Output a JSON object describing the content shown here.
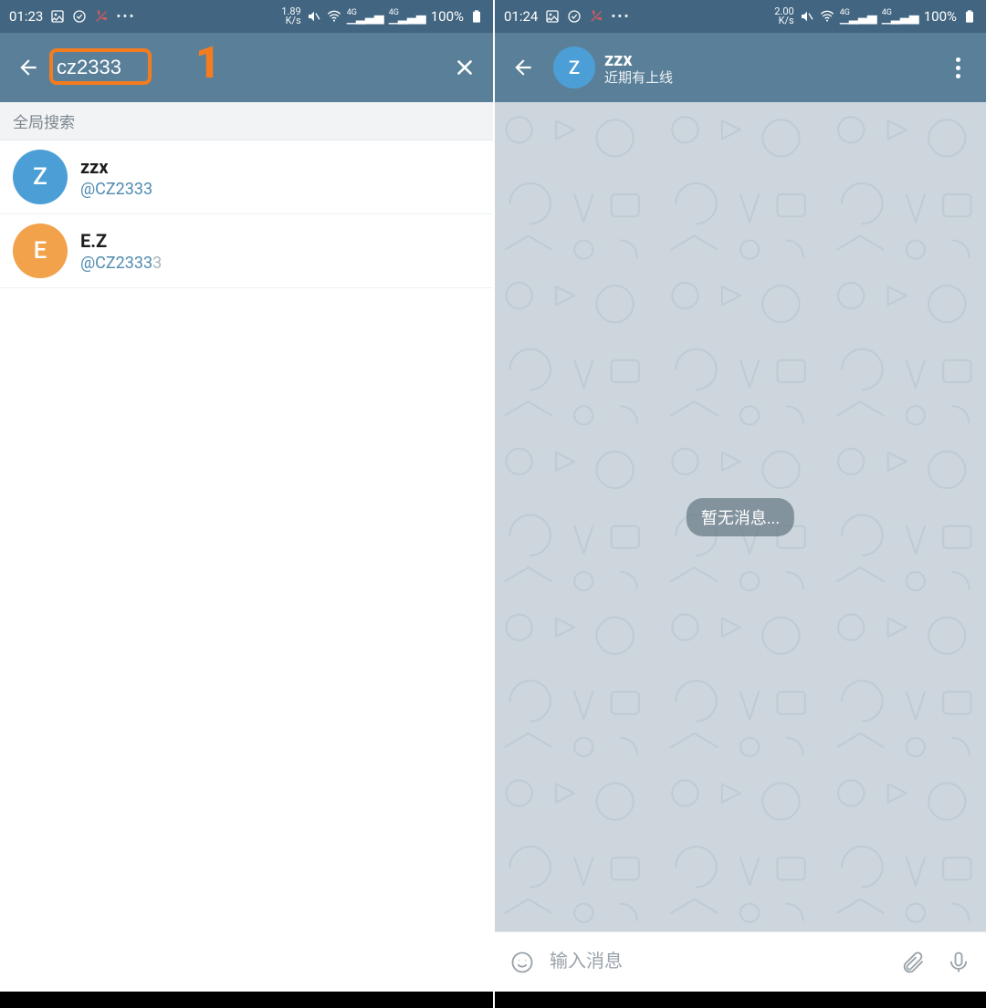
{
  "left": {
    "statusbar": {
      "time": "01:23",
      "kbs_top": "1.89",
      "kbs_bot": "K/s",
      "sig_label": "4G",
      "battery_pct": "100%"
    },
    "appbar": {
      "search_value": "cz2333"
    },
    "annotation": {
      "label": "1"
    },
    "section_header": "全局搜索",
    "results": [
      {
        "initial": "Z",
        "color": "#4c9fd6",
        "name": "zzx",
        "handle": "@CZ2333",
        "handle_dim": ""
      },
      {
        "initial": "E",
        "color": "#f2a24a",
        "name": "E.Z",
        "handle": "@CZ2333",
        "handle_dim": "3"
      }
    ]
  },
  "right": {
    "statusbar": {
      "time": "01:24",
      "kbs_top": "2.00",
      "kbs_bot": "K/s",
      "sig_label": "4G",
      "battery_pct": "100%"
    },
    "chat_header": {
      "avatar_initial": "Z",
      "avatar_color": "#4c9fd6",
      "title": "zzx",
      "subtitle": "近期有上线"
    },
    "empty_label": "暂无消息...",
    "compose": {
      "placeholder": "输入消息"
    }
  }
}
